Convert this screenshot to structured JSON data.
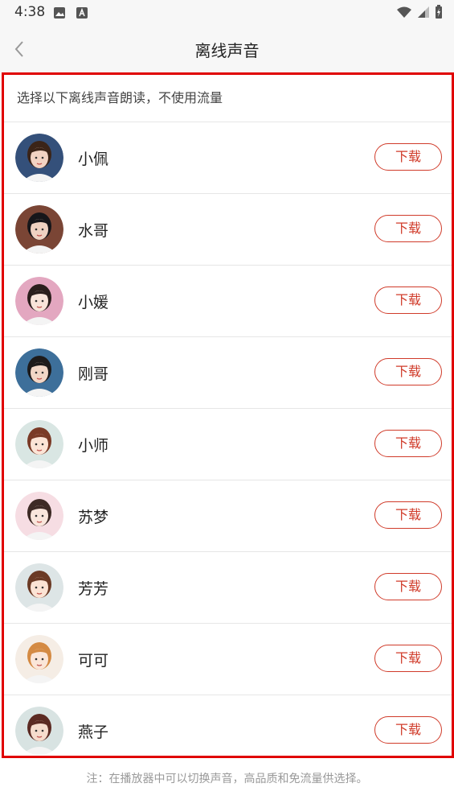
{
  "status_bar": {
    "time": "4:38"
  },
  "header": {
    "title": "离线声音"
  },
  "intro": "选择以下离线声音朗读，不使用流量",
  "voices": [
    {
      "name": "小佩",
      "action": "下载",
      "avatar_colors": {
        "bg": "#34507a",
        "hair": "#3b2418",
        "skin": "#f2d3c3"
      }
    },
    {
      "name": "水哥",
      "action": "下载",
      "avatar_colors": {
        "bg": "#7a4535",
        "hair": "#16161a",
        "skin": "#efd2c2"
      }
    },
    {
      "name": "小媛",
      "action": "下载",
      "avatar_colors": {
        "bg": "#e3a7c0",
        "hair": "#2a1e1c",
        "skin": "#f8e4da"
      }
    },
    {
      "name": "刚哥",
      "action": "下载",
      "avatar_colors": {
        "bg": "#3d6f9a",
        "hair": "#1d1a1a",
        "skin": "#f1d6c6"
      }
    },
    {
      "name": "小师",
      "action": "下载",
      "avatar_colors": {
        "bg": "#d9e6e3",
        "hair": "#7a3a26",
        "skin": "#fbe4d6"
      }
    },
    {
      "name": "苏梦",
      "action": "下载",
      "avatar_colors": {
        "bg": "#f6dde3",
        "hair": "#3d2a25",
        "skin": "#f9e6dc"
      }
    },
    {
      "name": "芳芳",
      "action": "下载",
      "avatar_colors": {
        "bg": "#dde5e6",
        "hair": "#6b3a25",
        "skin": "#fbe3d4"
      }
    },
    {
      "name": "可可",
      "action": "下载",
      "avatar_colors": {
        "bg": "#f5ede5",
        "hair": "#d48a43",
        "skin": "#fbe6d8"
      }
    },
    {
      "name": "燕子",
      "action": "下载",
      "avatar_colors": {
        "bg": "#d8e3e2",
        "hair": "#5b2a22",
        "skin": "#f6dccd"
      }
    }
  ],
  "footer": "注：在播放器中可以切换声音，高品质和免流量供选择。",
  "colors": {
    "accent": "#d03b2a",
    "highlight_frame": "#e00000"
  }
}
